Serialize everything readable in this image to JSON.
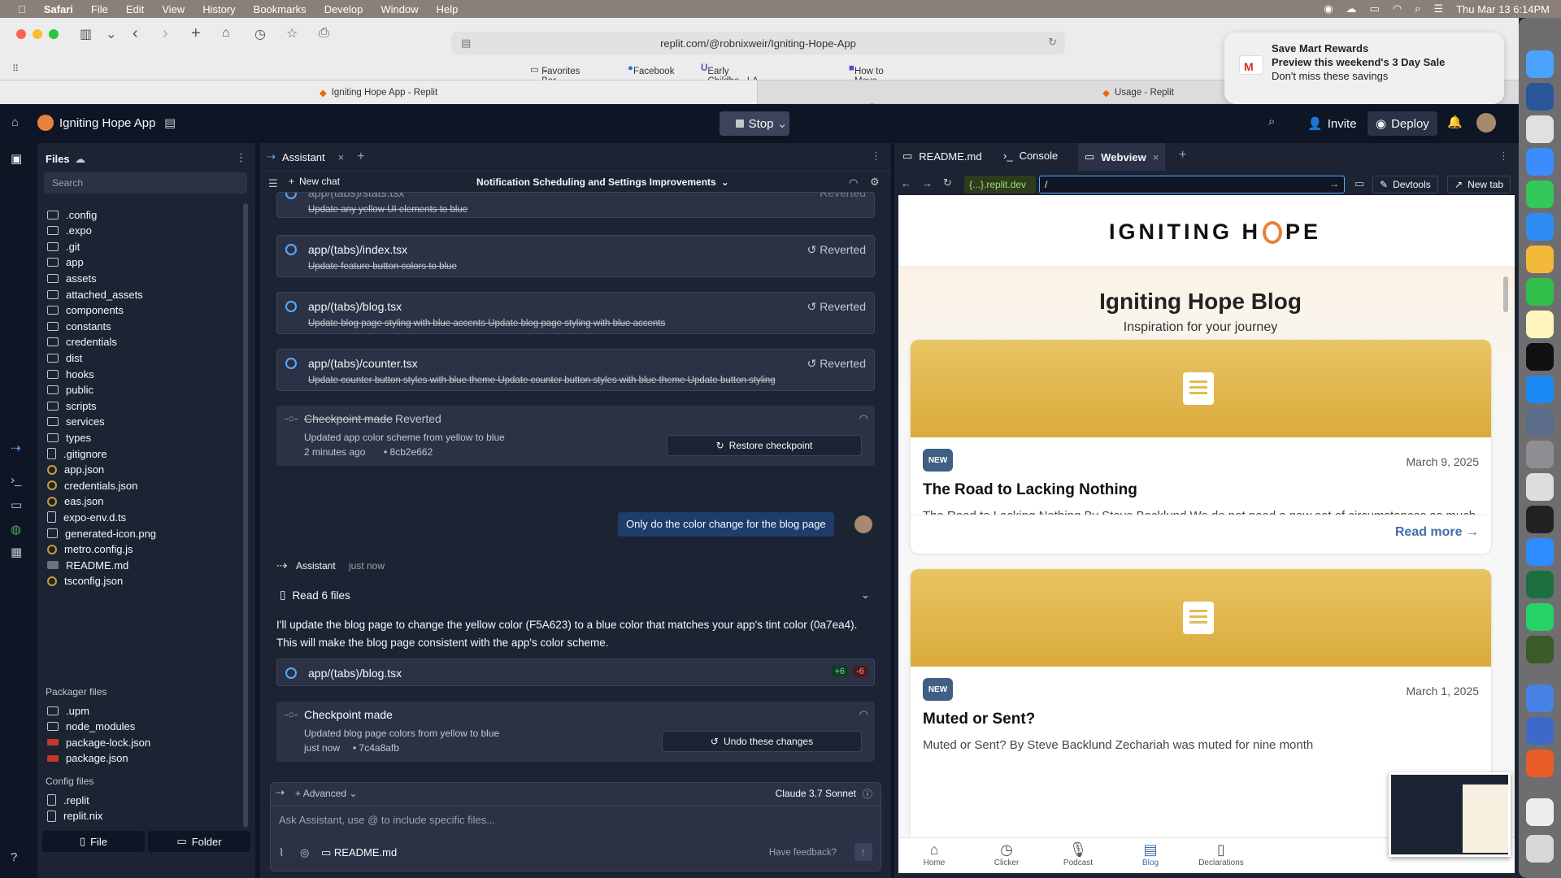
{
  "menubar": {
    "app": "Safari",
    "items": [
      "File",
      "Edit",
      "View",
      "History",
      "Bookmarks",
      "Develop",
      "Window",
      "Help"
    ],
    "datetime": "Thu Mar 13  6:14PM"
  },
  "safari": {
    "url": "replit.com/@robnixweir/Igniting-Hope-App",
    "favorites": [
      "Favorites Bar",
      "Facebook",
      "Early Childho...LA Extension",
      "How to Move ...ith Snapshot"
    ],
    "tabs": [
      "Igniting Hope App - Replit",
      "Usage - Replit"
    ]
  },
  "notification": {
    "title": "Save Mart Rewards",
    "subtitle": "Preview this weekend's 3 Day Sale",
    "body": "Don't miss these savings"
  },
  "topbar": {
    "app_name": "Igniting Hope App",
    "stop": "Stop",
    "invite": "Invite",
    "deploy": "Deploy"
  },
  "files": {
    "title": "Files",
    "search_placeholder": "Search",
    "items": [
      ".config",
      ".expo",
      ".git",
      "app",
      "assets",
      "attached_assets",
      "components",
      "constants",
      "credentials",
      "dist",
      "hooks",
      "public",
      "scripts",
      "services",
      "types",
      ".gitignore",
      "app.json",
      "credentials.json",
      "eas.json",
      "expo-env.d.ts",
      "generated-icon.png",
      "metro.config.js",
      "README.md",
      "tsconfig.json"
    ],
    "packager_title": "Packager files",
    "packager": [
      ".upm",
      "node_modules",
      "package-lock.json",
      "package.json"
    ],
    "config_title": "Config files",
    "config": [
      ".replit",
      "replit.nix"
    ],
    "new_file": "File",
    "new_folder": "Folder"
  },
  "assistant": {
    "tab": "Assistant",
    "new_chat": "New chat",
    "chat_title": "Notification Scheduling and Settings Improvements",
    "cards": [
      {
        "file": "app/(tabs)/stats.tsx",
        "desc": "Update any yellow UI elements to blue",
        "status": "Reverted"
      },
      {
        "file": "app/(tabs)/index.tsx",
        "desc": "Update feature button colors to blue",
        "status": "Reverted"
      },
      {
        "file": "app/(tabs)/blog.tsx",
        "desc": "Update blog page styling with blue accents Update blog page styling with blue accents",
        "status": "Reverted"
      },
      {
        "file": "app/(tabs)/counter.tsx",
        "desc": "Update counter button styles with blue theme Update counter button styles with blue theme Update button styling",
        "status": "Reverted"
      }
    ],
    "checkpoint1": {
      "title": "Checkpoint made",
      "status": "Reverted",
      "desc": "Updated app color scheme from yellow to blue",
      "time": "2 minutes ago",
      "hash": "8cb2e662",
      "button": "Restore checkpoint"
    },
    "user_msg": "Only do the color change for the blog page",
    "assistant_name": "Assistant",
    "assistant_time": "just now",
    "read_files": "Read 6 files",
    "reply": "I'll update the blog page to change the yellow color (F5A623) to a blue color that matches your app's tint color (0a7ea4). This will make the blog page consistent with the app's color scheme.",
    "edit_file": "app/(tabs)/blog.tsx",
    "added": "+6",
    "removed": "-6",
    "checkpoint2": {
      "title": "Checkpoint made",
      "desc": "Updated blog page colors from yellow to blue",
      "time": "just now",
      "hash": "7c4a8afb",
      "button": "Undo these changes"
    },
    "advanced": "Advanced",
    "model": "Claude 3.7 Sonnet",
    "input_placeholder": "Ask Assistant, use @ to include specific files...",
    "attached": "README.md",
    "feedback": "Have feedback?"
  },
  "webview": {
    "tabs": [
      "README.md",
      "Console",
      "Webview"
    ],
    "domain": "{...}.replit.dev",
    "path": "/",
    "devtools": "Devtools",
    "newtab": "New tab",
    "logo_left": "IGNITING H",
    "logo_right": "PE",
    "blog_title": "Igniting Hope Blog",
    "blog_sub": "Inspiration for your journey",
    "posts": [
      {
        "badge": "NEW",
        "date": "March 9, 2025",
        "title": "The Road to Lacking Nothing",
        "excerpt": "The Road to Lacking Nothing By Steve Backlund We do not need a new set of circumstances as much as we need a new set of beliefs . Steve......",
        "read_more": "Read more →"
      },
      {
        "badge": "NEW",
        "date": "March 1, 2025",
        "title": "Muted or Sent?",
        "excerpt": "Muted or Sent? By Steve Backlund  Zechariah was muted for nine month"
      }
    ],
    "nav": [
      "Home",
      "Clicker",
      "Podcast",
      "Blog",
      "Declarations"
    ],
    "accent": "#3f6fa8"
  }
}
